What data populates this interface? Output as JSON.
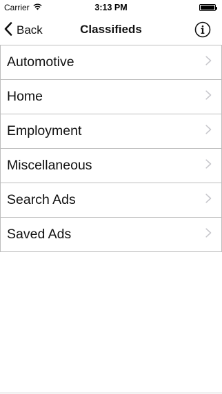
{
  "status_bar": {
    "carrier": "Carrier",
    "time": "3:13 PM",
    "wifi_icon": "wifi-icon",
    "battery_icon": "battery-icon",
    "battery_level": 1.0
  },
  "nav": {
    "back_label": "Back",
    "back_icon": "chevron-left-icon",
    "title": "Classifieds",
    "info_icon": "info-circle-icon"
  },
  "list": {
    "items": [
      {
        "label": "Automotive"
      },
      {
        "label": "Home"
      },
      {
        "label": "Employment"
      },
      {
        "label": "Miscellaneous"
      },
      {
        "label": "Search Ads"
      },
      {
        "label": "Saved Ads"
      }
    ],
    "chevron_icon": "chevron-right-icon"
  },
  "colors": {
    "separator": "#bdbdbd",
    "chevron": "#c7c7cc",
    "text": "#111111"
  }
}
